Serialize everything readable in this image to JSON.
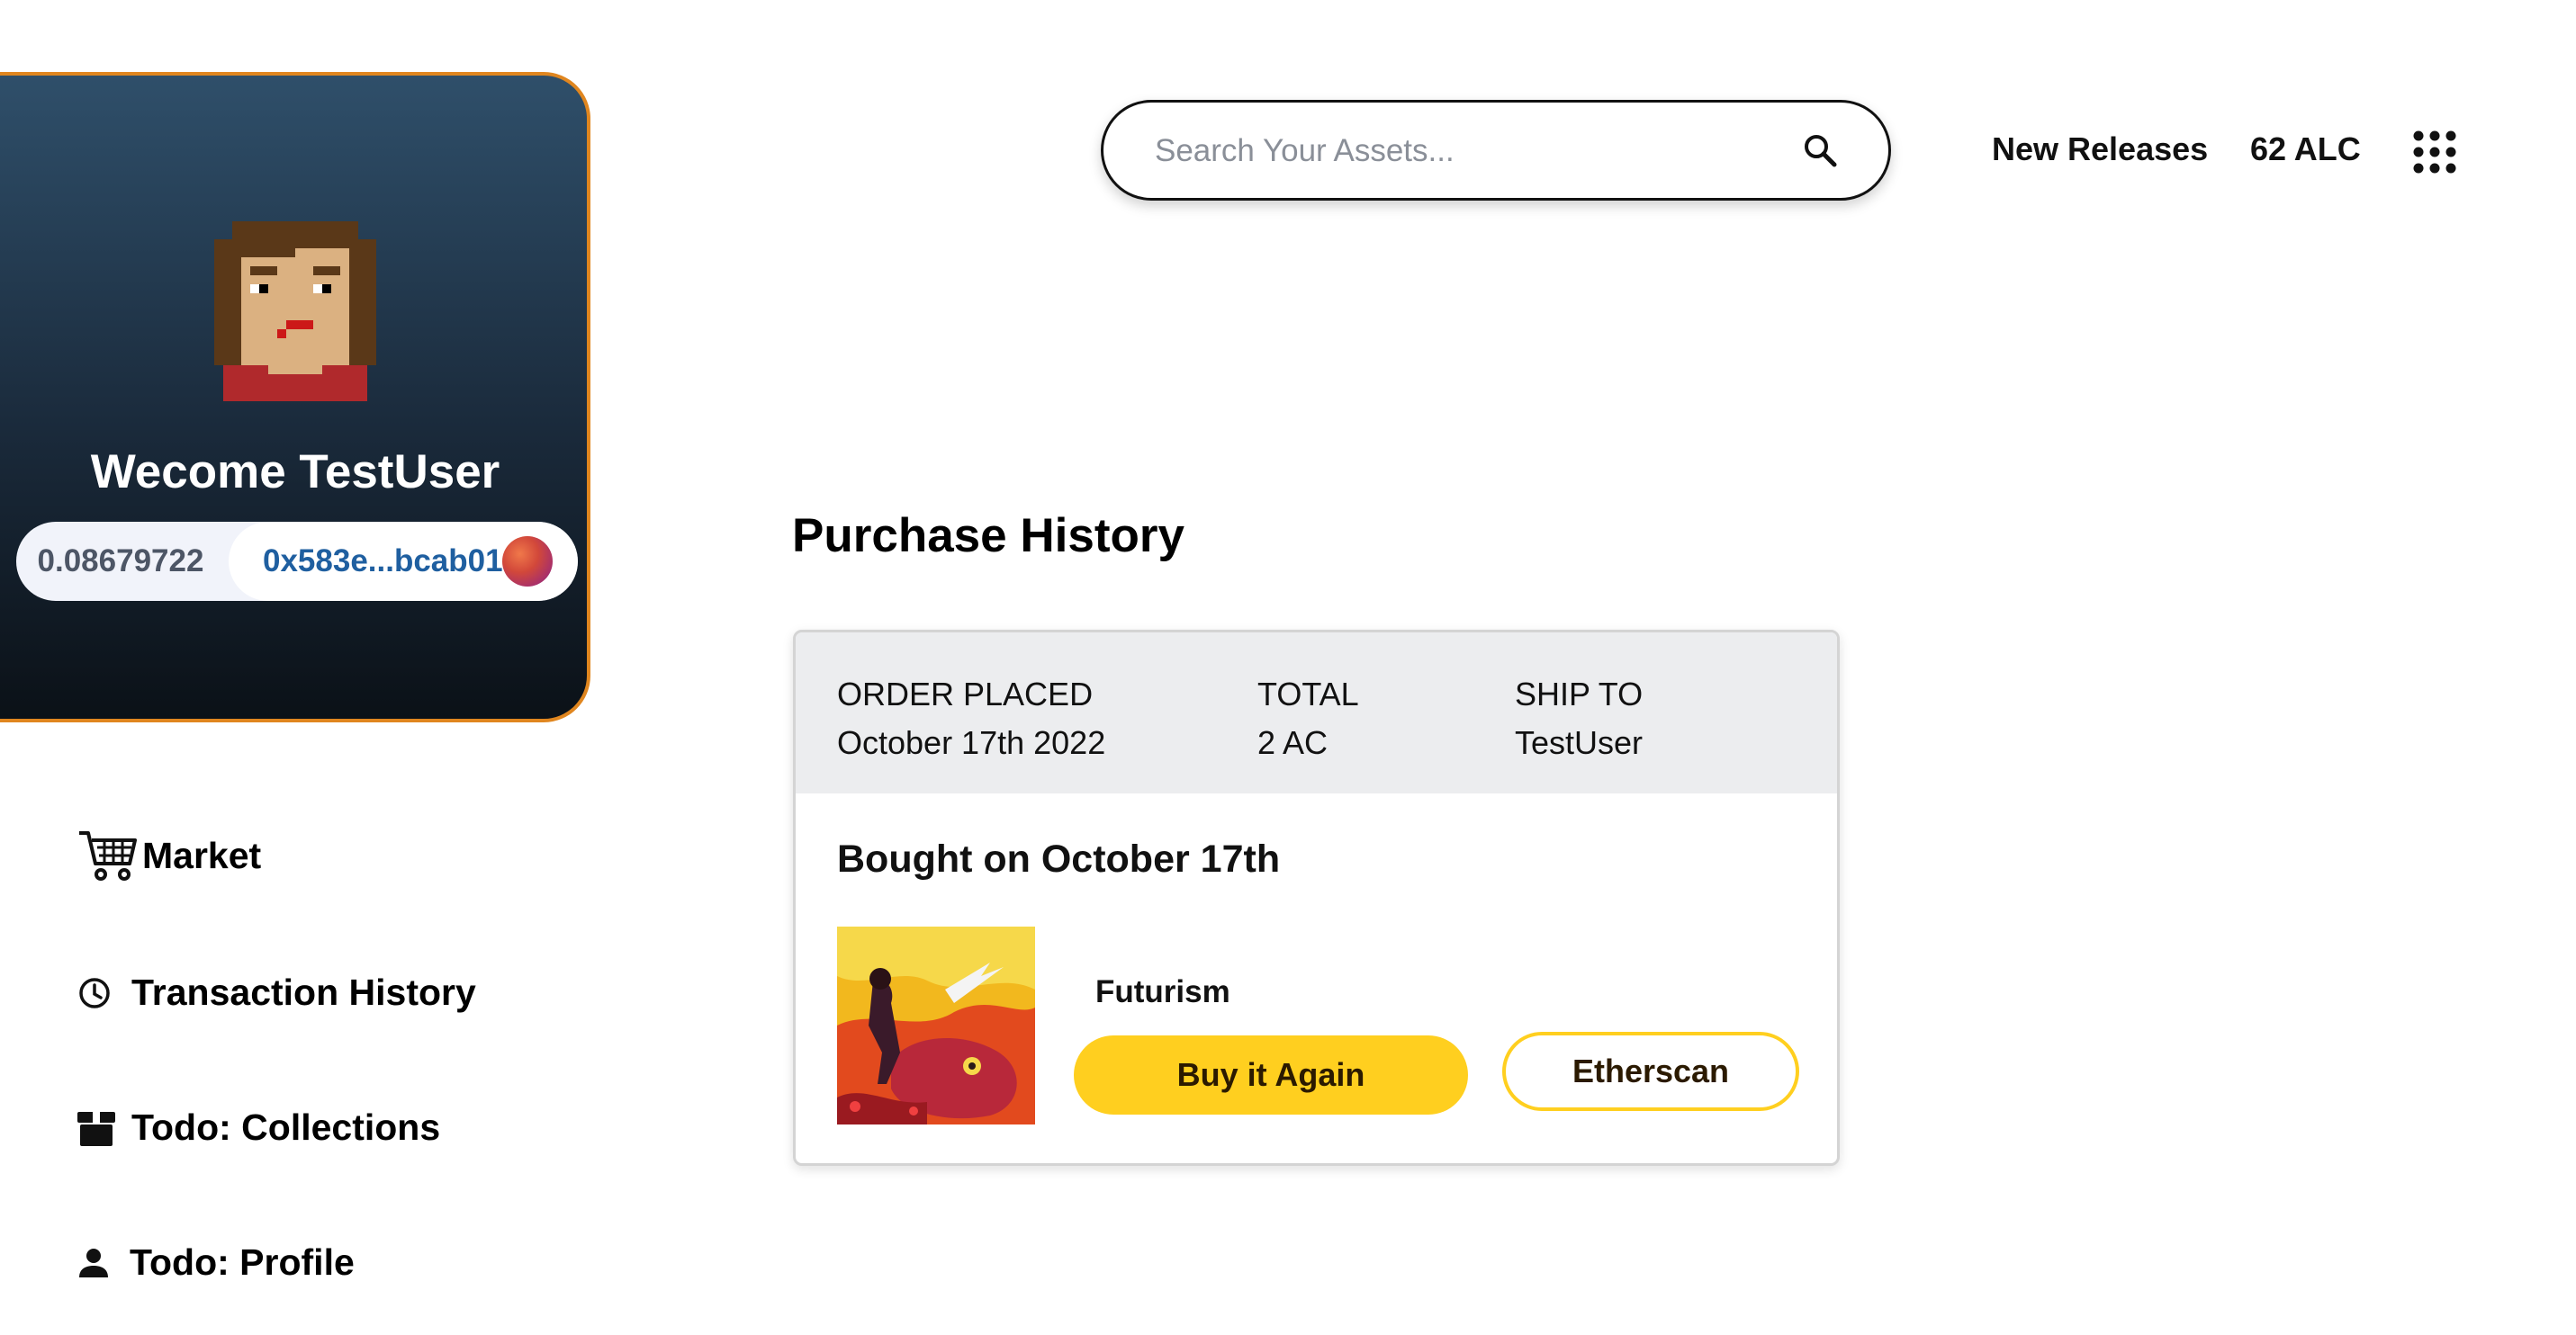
{
  "profile": {
    "welcome_text": "Wecome TestUser",
    "balance": "0.08679722",
    "address": "0x583e...bcab01",
    "avatar_icon": "pixel-avatar-icon",
    "identicon": "wallet-identicon"
  },
  "sidebar": {
    "items": [
      {
        "label": "Market",
        "icon": "cart-icon"
      },
      {
        "label": "Transaction History",
        "icon": "clock-icon"
      },
      {
        "label": "Todo: Collections",
        "icon": "box-icon"
      },
      {
        "label": "Todo: Profile",
        "icon": "person-icon"
      }
    ]
  },
  "header": {
    "search": {
      "placeholder": "Search Your Assets...",
      "value": ""
    },
    "new_releases": "New Releases",
    "token_balance": "62 ALC",
    "apps_icon": "grid-dots-icon"
  },
  "main": {
    "title": "Purchase History",
    "order": {
      "placed_label": "ORDER PLACED",
      "placed_value": "October 17th 2022",
      "total_label": "TOTAL",
      "total_value": "2 AC",
      "ship_label": "SHIP TO",
      "ship_value": "TestUser",
      "bought_title": "Bought on October 17th",
      "product_name": "Futurism",
      "buy_again_label": "Buy it Again",
      "etherscan_label": "Etherscan"
    }
  },
  "colors": {
    "accent_yellow": "#ffcf1f",
    "card_border_orange": "#e0861f",
    "address_blue": "#1f5fa0",
    "order_header_bg": "#ecedef"
  }
}
